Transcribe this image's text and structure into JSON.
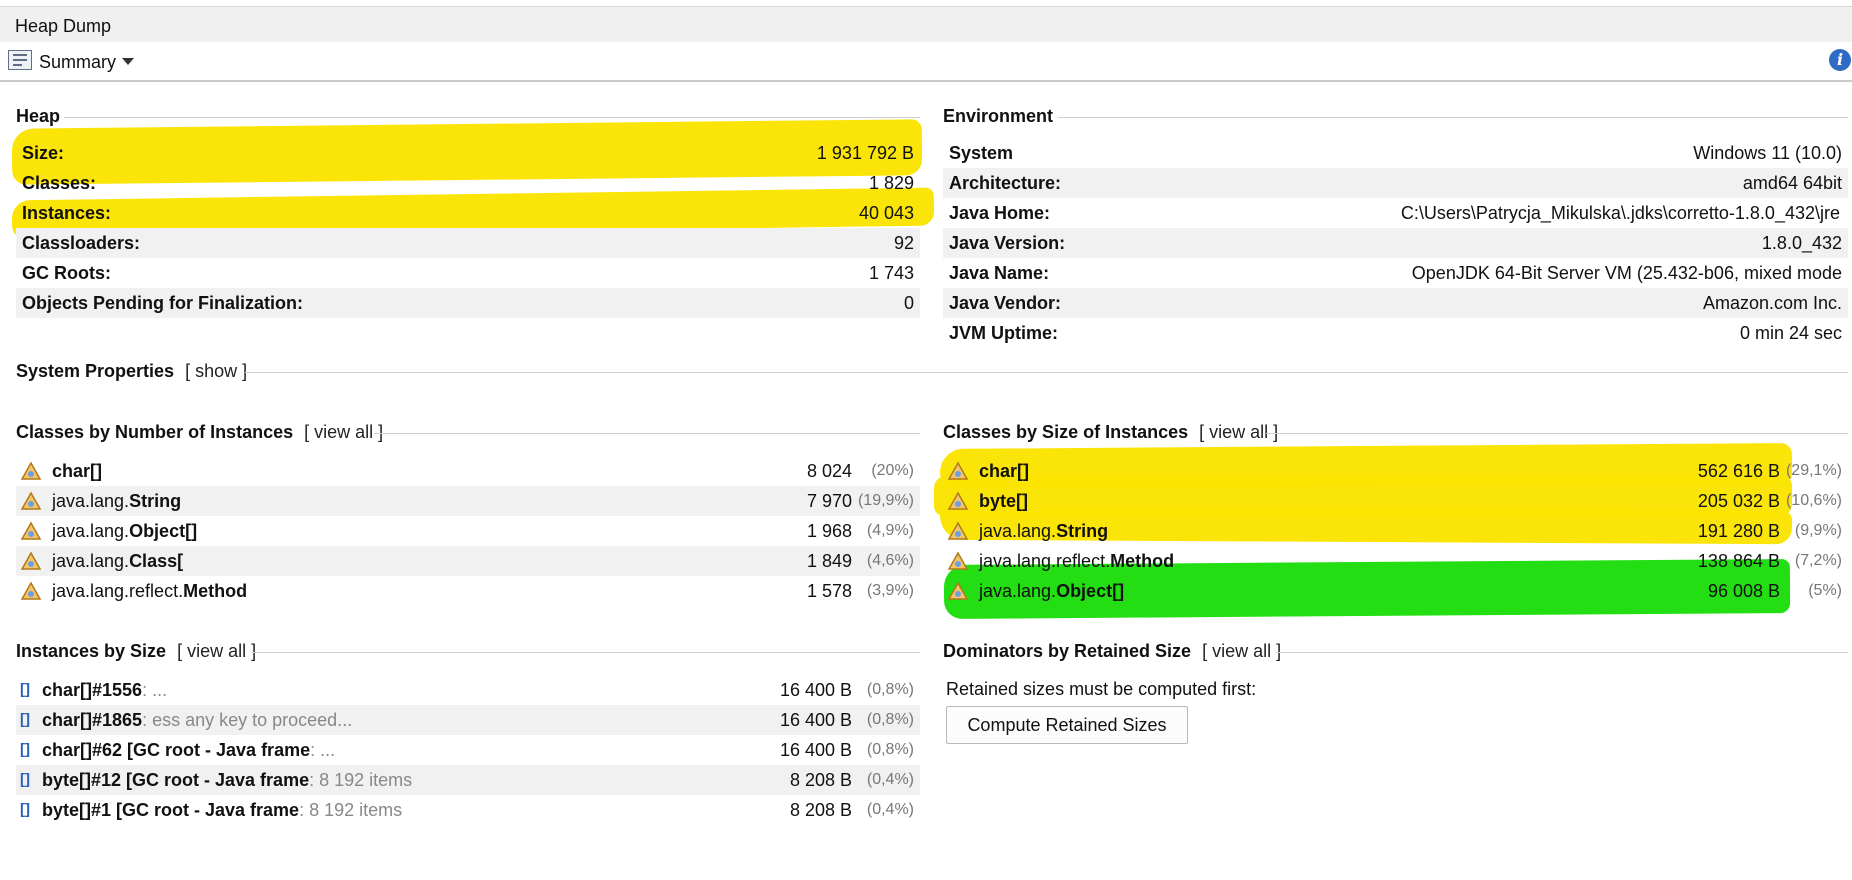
{
  "window": {
    "title": "Heap Dump"
  },
  "toolbar": {
    "view_label": "Summary",
    "view_icon": "summary-icon",
    "info_icon": "info-icon"
  },
  "heap": {
    "title": "Heap",
    "rows": [
      {
        "label": "Size:",
        "value": "1 931 792 B"
      },
      {
        "label": "Classes:",
        "value": "1 829"
      },
      {
        "label": "Instances:",
        "value": "40 043"
      },
      {
        "label": "Classloaders:",
        "value": "92"
      },
      {
        "label": "GC Roots:",
        "value": "1 743"
      },
      {
        "label": "Objects Pending for Finalization:",
        "value": "0"
      }
    ]
  },
  "environment": {
    "title": "Environment",
    "rows": [
      {
        "label": "System",
        "value": "Windows 11 (10.0)"
      },
      {
        "label": "Architecture:",
        "value": "amd64 64bit"
      },
      {
        "label": "Java Home:",
        "value": "C:\\Users\\Patrycja_Mikulska\\.jdks\\corretto-1.8.0_432\\jre"
      },
      {
        "label": "Java Version:",
        "value": "1.8.0_432"
      },
      {
        "label": "Java Name:",
        "value": "OpenJDK 64-Bit Server VM (25.432-b06, mixed mode"
      },
      {
        "label": "Java Vendor:",
        "value": "Amazon.com Inc."
      },
      {
        "label": "JVM Uptime:",
        "value": "0 min 24 sec"
      }
    ]
  },
  "system_properties": {
    "title": "System Properties",
    "link": "[ show ]"
  },
  "classes_by_number": {
    "title": "Classes by Number of Instances",
    "link": "[ view all ]",
    "rows": [
      {
        "pkg": "",
        "name": "char[]",
        "value": "8 024",
        "pct": "(20%)"
      },
      {
        "pkg": "java.lang.",
        "name": "String",
        "value": "7 970",
        "pct": "(19,9%)"
      },
      {
        "pkg": "java.lang.",
        "name": "Object[]",
        "value": "1 968",
        "pct": "(4,9%)"
      },
      {
        "pkg": "java.lang.",
        "name": "Class[",
        "value": "1 849",
        "pct": "(4,6%)"
      },
      {
        "pkg": "java.lang.reflect.",
        "name": "Method",
        "value": "1 578",
        "pct": "(3,9%)"
      }
    ]
  },
  "classes_by_size": {
    "title": "Classes by Size of Instances",
    "link": "[ view all ]",
    "rows": [
      {
        "pkg": "",
        "name": "char[]",
        "value": "562 616 B",
        "pct": "(29,1%)"
      },
      {
        "pkg": "",
        "name": "byte[]",
        "value": "205 032 B",
        "pct": "(10,6%)"
      },
      {
        "pkg": "java.lang.",
        "name": "String",
        "value": "191 280 B",
        "pct": "(9,9%)"
      },
      {
        "pkg": "java.lang.reflect.",
        "name": "Method",
        "value": "138 864 B",
        "pct": "(7,2%)"
      },
      {
        "pkg": "java.lang.",
        "name": "Object[]",
        "value": "96 008 B",
        "pct": "(5%)"
      }
    ]
  },
  "instances_by_size": {
    "title": "Instances by Size",
    "link": "[ view all ]",
    "rows": [
      {
        "name": "char[]#1556",
        "detail": ": ...",
        "value": "16 400 B",
        "pct": "(0,8%)"
      },
      {
        "name": "char[]#1865",
        "detail": ": ess any key to proceed...",
        "value": "16 400 B",
        "pct": "(0,8%)"
      },
      {
        "name": "char[]#62 [GC root - Java frame",
        "detail": ": ...",
        "value": "16 400 B",
        "pct": "(0,8%)"
      },
      {
        "name": "byte[]#12 [GC root - Java frame",
        "detail": ": 8 192 items",
        "value": "8 208 B",
        "pct": "(0,4%)"
      },
      {
        "name": "byte[]#1 [GC root - Java frame",
        "detail": ": 8 192 items",
        "value": "8 208 B",
        "pct": "(0,4%)"
      }
    ]
  },
  "dominators": {
    "title": "Dominators by Retained Size",
    "link": "[ view all ]",
    "message": "Retained sizes must be computed first:",
    "button": "Compute Retained Sizes"
  },
  "colors": {
    "highlight_yellow": "#fbe400",
    "highlight_green": "#23de12",
    "info_blue": "#2e6cc4"
  }
}
